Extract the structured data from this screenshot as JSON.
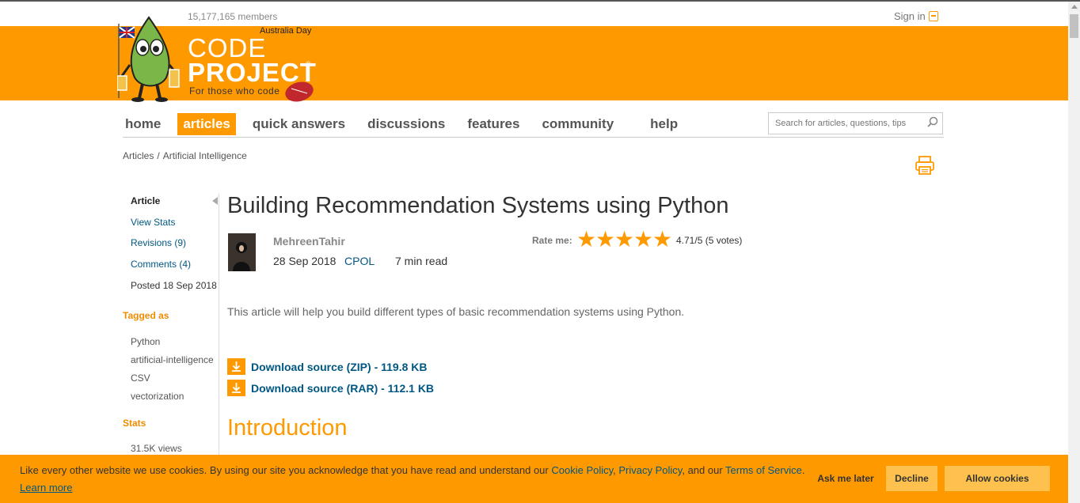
{
  "header": {
    "members": "15,177,165 members",
    "sign_in": "Sign in",
    "holiday": "Australia Day",
    "logo_line1": "CODE",
    "logo_line2": "PROJECT",
    "logo_reg": "®",
    "tagline": "For those who code",
    "brand_color": "#ff9900"
  },
  "nav": {
    "items": [
      {
        "label": "home"
      },
      {
        "label": "articles",
        "active": true
      },
      {
        "label": "quick answers"
      },
      {
        "label": "discussions"
      },
      {
        "label": "features"
      },
      {
        "label": "community"
      },
      {
        "label": "help"
      }
    ],
    "search_placeholder": "Search for articles, questions, tips"
  },
  "breadcrumb": {
    "items": [
      "Articles",
      "/",
      "Artificial Intelligence"
    ]
  },
  "sidebar": {
    "article": "Article",
    "view_stats": "View Stats",
    "revisions": "Revisions (9)",
    "comments": "Comments (4)",
    "posted": "Posted 18 Sep 2018",
    "tagged_heading": "Tagged as",
    "tags": [
      "Python",
      "artificial-intelligence",
      "CSV",
      "vectorization"
    ],
    "stats_heading": "Stats",
    "views": "31.5K views"
  },
  "article": {
    "title": "Building Recommendation Systems using Python",
    "author": "MehreenTahir",
    "date": "28 Sep 2018",
    "license": "CPOL",
    "read_time": "7 min read",
    "rate_label": "Rate me:",
    "stars": 5,
    "rating": "4.71/5 (5 votes)",
    "summary": "This article will help you build different types of basic recommendation systems using Python.",
    "downloads": [
      {
        "label": "Download source (ZIP) - 119.8 KB"
      },
      {
        "label": "Download source (RAR) - 112.1 KB"
      }
    ],
    "section_heading": "Introduction"
  },
  "cookie_bar": {
    "text_before": "Like every other website we use cookies. By using our site you acknowledge that you have read and understand our ",
    "cookie_policy": "Cookie Policy",
    "sep1": ", ",
    "privacy_policy": "Privacy Policy",
    "sep2": ", and our ",
    "terms": "Terms of Service",
    "text_after": ".",
    "learn_more": "Learn more",
    "ask_later": "Ask me later",
    "decline": "Decline",
    "allow": "Allow cookies"
  }
}
